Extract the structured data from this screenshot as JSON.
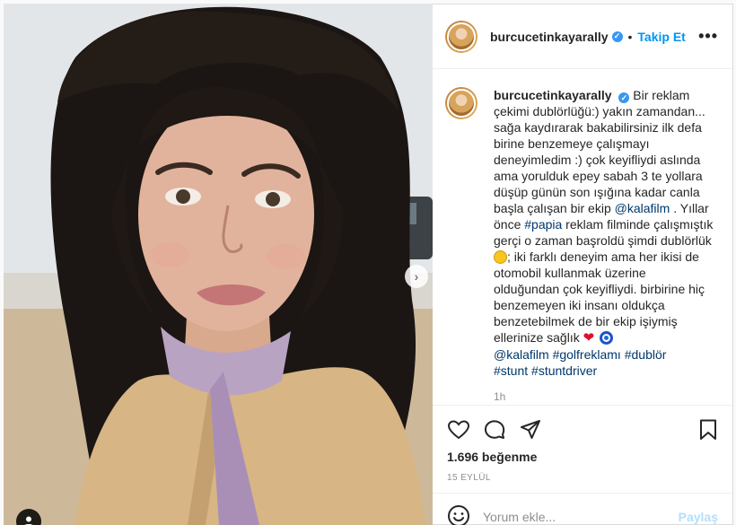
{
  "header": {
    "username": "burcucetinkayarally",
    "separator": "•",
    "follow_label": "Takip Et",
    "more_icon": "more-horizontal-icon"
  },
  "caption": {
    "username": "burcucetinkayarally",
    "text_1": " Bir reklam çekimi dublörlüğü:) yakın zamandan... sağa kaydırarak bakabilirsiniz ilk defa birine benzemeye çalışmayı deneyimledim :) çok keyifliydi aslında ama yorulduk epey sabah 3 te yollara düşüp günün son ışığına kadar canla başla çalışan bir ekip ",
    "mention_1": "@kalafilm",
    "text_2": " . Yıllar önce ",
    "hashtag_papia": "#papia",
    "text_3": " reklam filminde çalışmıştık gerçi o zaman başroldü şimdi dublörlük ",
    "text_4": "; iki farklı deneyim ama her ikisi de otomobil kullanmak üzerine olduğundan çok keyifliydi. birbirine hiç benzemeyen iki insanı oldukça benzetebilmek de bir ekip işiymiş ellerinize sağlık ",
    "heart": "❤",
    "mention_2": "@kalafilm",
    "hashtag_golf": "#golfreklamı",
    "hashtag_dublor": "#dublör",
    "hashtag_stunt": "#stunt",
    "hashtag_stuntdriver": "#stuntdriver",
    "time": "1h"
  },
  "actions": {
    "like_icon": "heart-icon",
    "comment_icon": "comment-icon",
    "share_icon": "send-icon",
    "save_icon": "bookmark-icon"
  },
  "likes": "1.696 beğenme",
  "date": "15 EYLÜL",
  "comment_box": {
    "placeholder": "Yorum ekle...",
    "post_label": "Paylaş"
  },
  "colors": {
    "accent": "#0095f6",
    "verified": "#3897f0",
    "post_disabled": "#b2dffc",
    "muted": "#8e8e8e"
  }
}
